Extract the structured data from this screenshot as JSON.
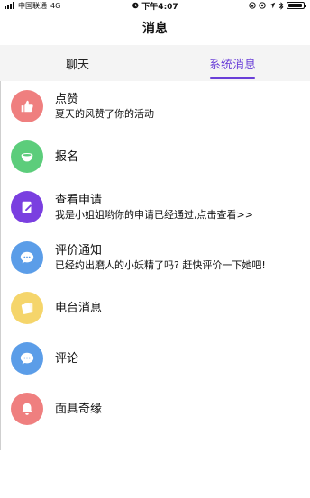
{
  "status_bar": {
    "carrier": "中国联通",
    "network": "4G",
    "time": "下午4:07"
  },
  "header": {
    "title": "消息"
  },
  "tabs": [
    {
      "label": "聊天",
      "active": false
    },
    {
      "label": "系统消息",
      "active": true
    }
  ],
  "accent_color": "#6a3fd8",
  "items": [
    {
      "title": "点赞",
      "subtitle": "夏天的风赞了你的活动",
      "icon": "thumbs-up-icon",
      "color": "#ef7f7f"
    },
    {
      "title": "报名",
      "subtitle": "",
      "icon": "bowl-icon",
      "color": "#5ccd7b"
    },
    {
      "title": "查看申请",
      "subtitle": "我是小姐姐哟你的申请已经通过,点击查看>>",
      "icon": "edit-document-icon",
      "color": "#7a3fe0"
    },
    {
      "title": "评价通知",
      "subtitle": "已经约出磨人的小妖精了吗? 赶快评价一下她吧!",
      "icon": "chat-bubble-icon",
      "color": "#5b9de8"
    },
    {
      "title": "电台消息",
      "subtitle": "",
      "icon": "notes-icon",
      "color": "#f5d56b"
    },
    {
      "title": "评论",
      "subtitle": "",
      "icon": "chat-bubble-icon",
      "color": "#5b9de8"
    },
    {
      "title": "面具奇缘",
      "subtitle": "",
      "icon": "bell-icon",
      "color": "#ef7f7f"
    }
  ]
}
